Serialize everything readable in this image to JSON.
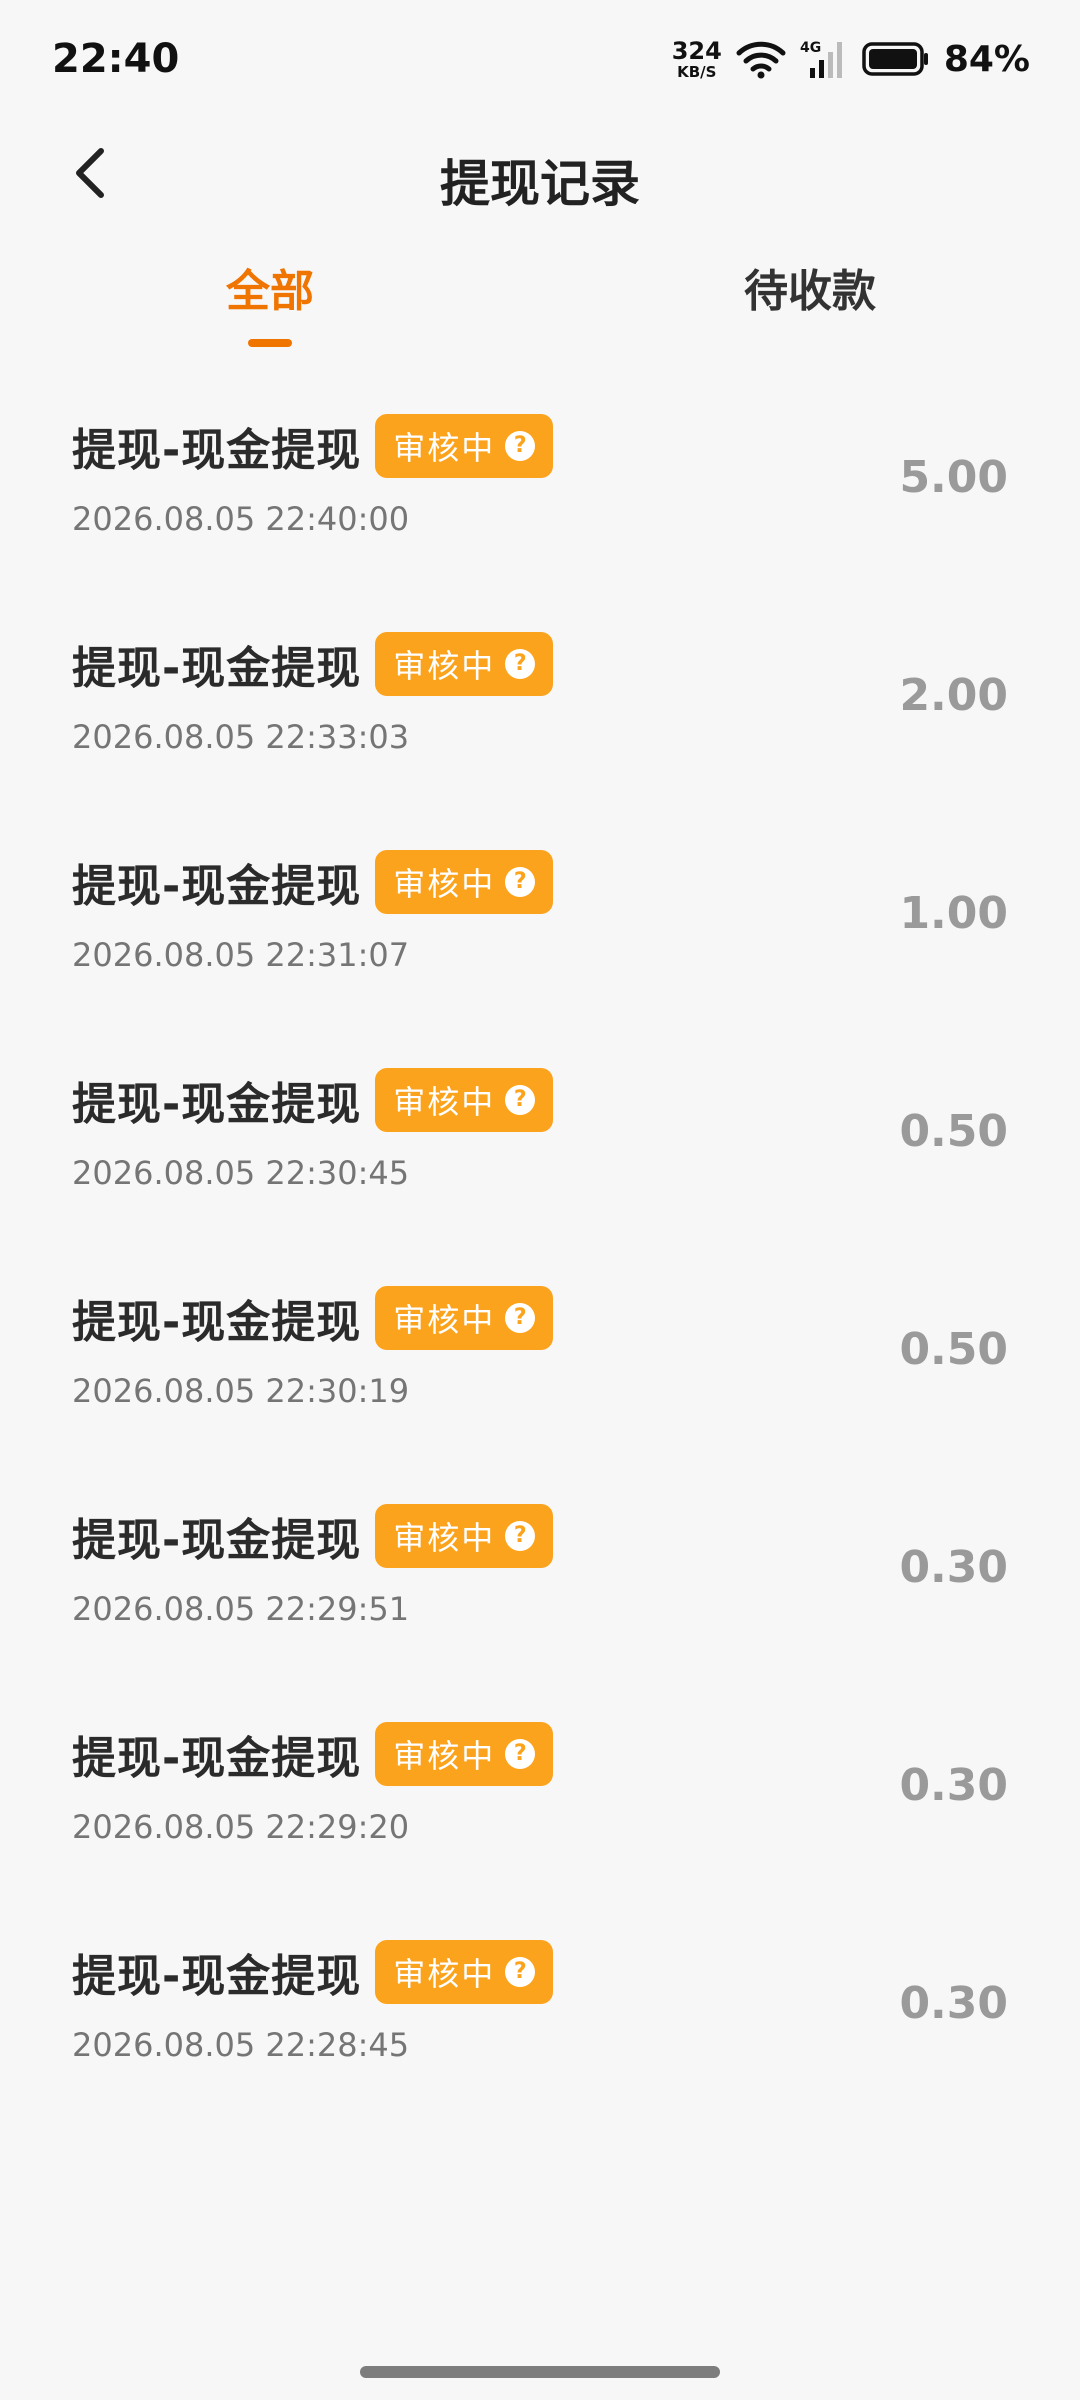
{
  "status_bar": {
    "time": "22:40",
    "net_speed": "324",
    "net_unit": "KB/S",
    "cell_type": "4G",
    "battery": "84%"
  },
  "header": {
    "title": "提现记录"
  },
  "tabs": [
    {
      "label": "全部",
      "active": true
    },
    {
      "label": "待收款",
      "active": false
    }
  ],
  "colors": {
    "accent": "#f07400",
    "badge": "#fba31c",
    "amount": "#9a9a9a"
  },
  "records": [
    {
      "title": "提现-现金提现",
      "status": "审核中",
      "time": "2026.08.05 22:40:00",
      "amount": "5.00"
    },
    {
      "title": "提现-现金提现",
      "status": "审核中",
      "time": "2026.08.05 22:33:03",
      "amount": "2.00"
    },
    {
      "title": "提现-现金提现",
      "status": "审核中",
      "time": "2026.08.05 22:31:07",
      "amount": "1.00"
    },
    {
      "title": "提现-现金提现",
      "status": "审核中",
      "time": "2026.08.05 22:30:45",
      "amount": "0.50"
    },
    {
      "title": "提现-现金提现",
      "status": "审核中",
      "time": "2026.08.05 22:30:19",
      "amount": "0.50"
    },
    {
      "title": "提现-现金提现",
      "status": "审核中",
      "time": "2026.08.05 22:29:51",
      "amount": "0.30"
    },
    {
      "title": "提现-现金提现",
      "status": "审核中",
      "time": "2026.08.05 22:29:20",
      "amount": "0.30"
    },
    {
      "title": "提现-现金提现",
      "status": "审核中",
      "time": "2026.08.05 22:28:45",
      "amount": "0.30"
    }
  ]
}
